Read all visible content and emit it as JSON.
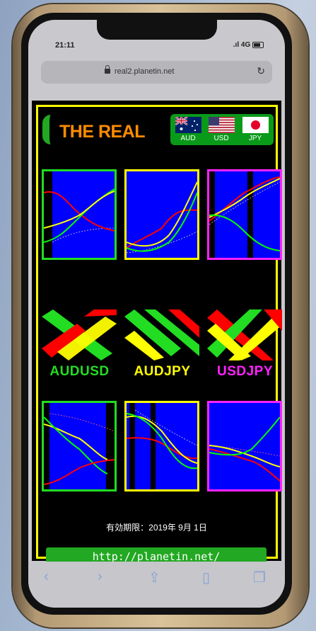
{
  "status_bar": {
    "time": "21:11",
    "network": ".ıl 4G"
  },
  "browser": {
    "url": "real2.planetin.net"
  },
  "header": {
    "title": "THE REAL"
  },
  "currencies": [
    {
      "code": "AUD",
      "flag": "australia-flag-icon"
    },
    {
      "code": "USD",
      "flag": "usa-flag-icon"
    },
    {
      "code": "JPY",
      "flag": "japan-flag-icon"
    }
  ],
  "pairs": [
    {
      "label": "AUDUSD",
      "color": "#22dd22"
    },
    {
      "label": "AUDJPY",
      "color": "#ffff00"
    },
    {
      "label": "USDJPY",
      "color": "#ff22ff"
    }
  ],
  "footer": {
    "expiry": "有効期限：2019年 9月 1日",
    "link": "http://planetin.net/"
  },
  "colors": {
    "frame": "#ffff00",
    "green": "#22a822",
    "title": "#ff8c00",
    "chart_bg": "#0000ff"
  }
}
